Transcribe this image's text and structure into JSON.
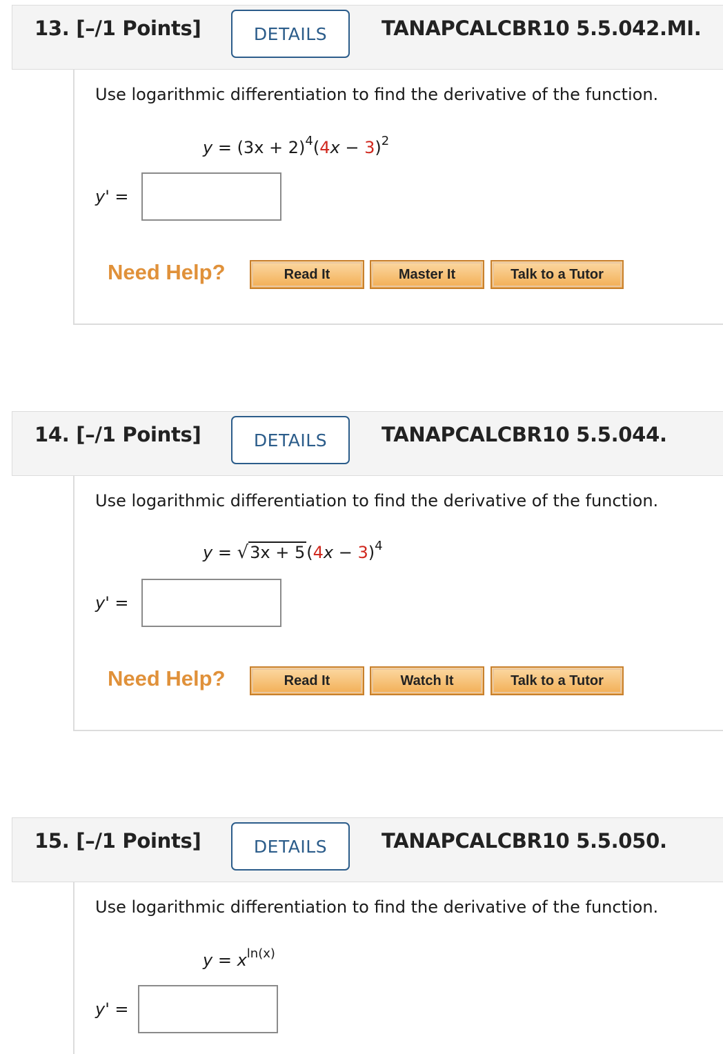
{
  "questions": [
    {
      "number": "13.",
      "points": "[–/1 Points]",
      "details_label": "DETAILS",
      "code": "TANAPCALCBR10 5.5.042.MI.",
      "prompt": "Use logarithmic differentiation to find the derivative of the function.",
      "equation_parts": [
        "y",
        " = (3x + 2)",
        "4",
        "(",
        "4",
        "x − ",
        "3",
        ")",
        "2"
      ],
      "answer_label": "y' =",
      "answer_value": "",
      "need_help": "Need Help?",
      "help_buttons": [
        "Read It",
        "Master It",
        "Talk to a Tutor"
      ]
    },
    {
      "number": "14.",
      "points": "[–/1 Points]",
      "details_label": "DETAILS",
      "code": "TANAPCALCBR10 5.5.044.",
      "prompt": "Use logarithmic differentiation to find the derivative of the function.",
      "equation_parts": [
        "y",
        " = ",
        "√",
        "3x + 5",
        "(",
        "4",
        "x − ",
        "3",
        ")",
        "4"
      ],
      "answer_label": "y' =",
      "answer_value": "",
      "need_help": "Need Help?",
      "help_buttons": [
        "Read It",
        "Watch It",
        "Talk to a Tutor"
      ]
    },
    {
      "number": "15.",
      "points": "[–/1 Points]",
      "details_label": "DETAILS",
      "code": "TANAPCALCBR10 5.5.050.",
      "prompt": "Use logarithmic differentiation to find the derivative of the function.",
      "equation_parts": [
        "y",
        " = ",
        "x",
        "ln(x)"
      ],
      "answer_label": "y' =",
      "answer_value": ""
    }
  ],
  "colors": {
    "details_border": "#2b5c8a",
    "red_value": "#d0281e",
    "need_help": "#e0913a",
    "help_button": "#f2ae54"
  }
}
